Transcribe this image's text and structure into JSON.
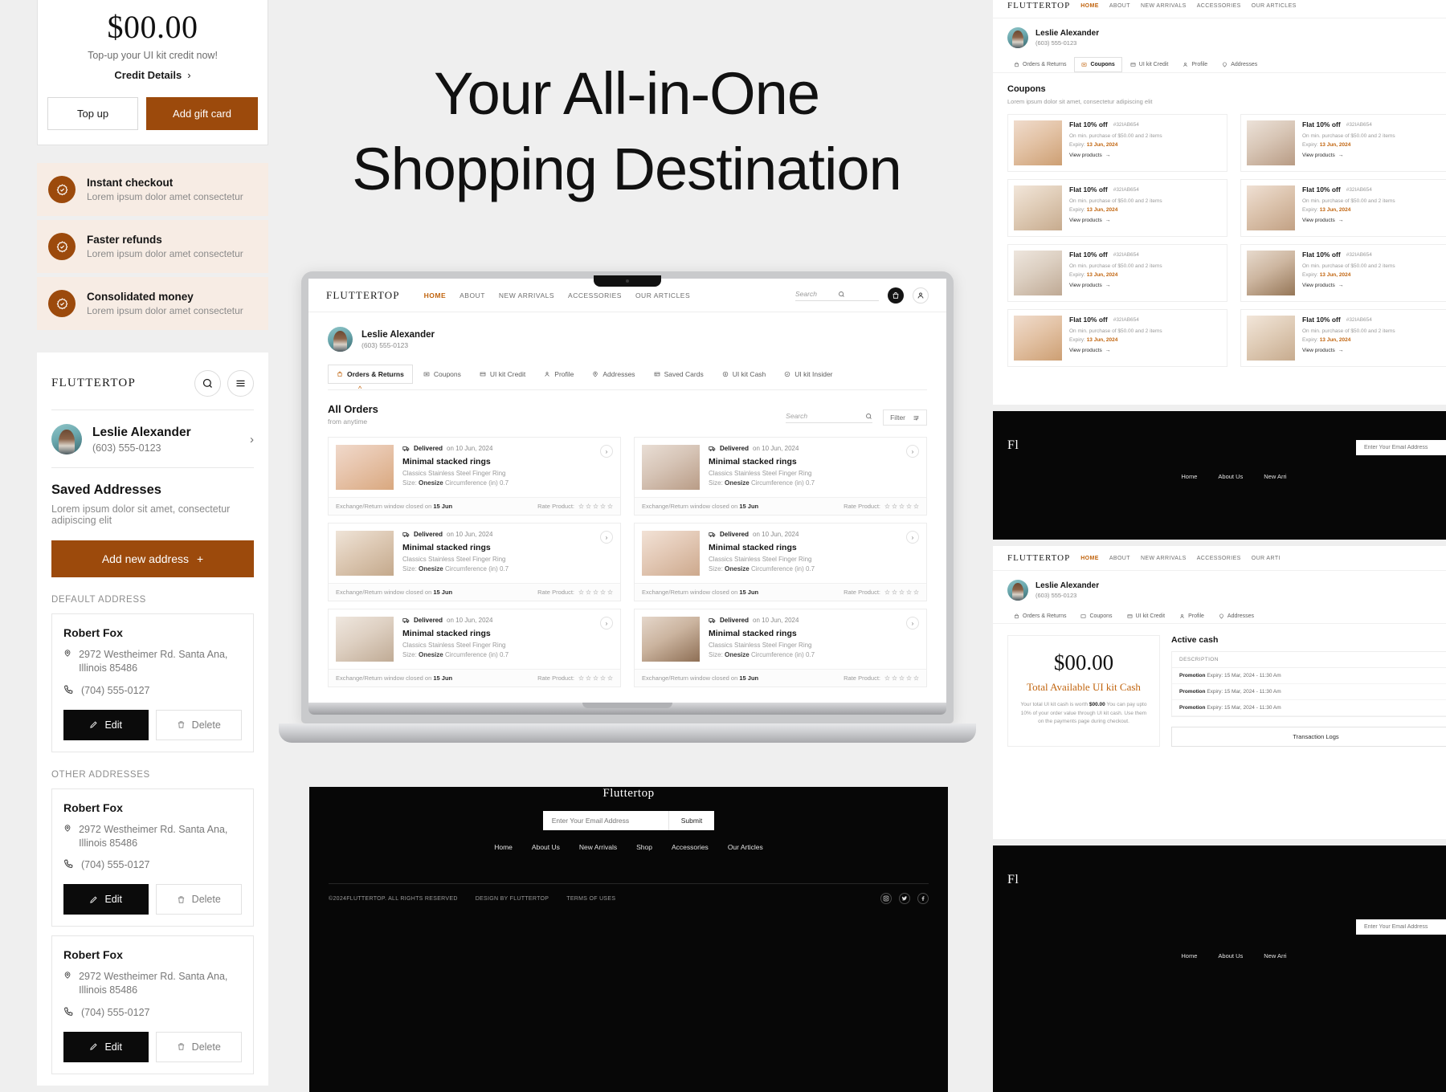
{
  "hero": {
    "line1": "Your All-in-One",
    "line2": "Shopping Destination"
  },
  "credit": {
    "amount": "$00.00",
    "subtitle": "Top-up your UI kit credit now!",
    "details_link": "Credit Details",
    "chevron": "›",
    "topup_label": "Top up",
    "gift_label": "Add gift card"
  },
  "features": [
    {
      "title": "Instant checkout",
      "desc": "Lorem ipsum dolor amet consectetur"
    },
    {
      "title": "Faster refunds",
      "desc": "Lorem ipsum dolor amet consectetur"
    },
    {
      "title": "Consolidated money",
      "desc": "Lorem ipsum dolor amet consectetur"
    }
  ],
  "address_panel": {
    "brand": "FLUTTERTOP",
    "user": {
      "name": "Leslie Alexander",
      "phone": "(603) 555-0123",
      "chevron": "›"
    },
    "section_title": "Saved Addresses",
    "section_desc": "Lorem ipsum dolor sit amet, consectetur adipiscing elit",
    "add_label": "Add new address",
    "add_plus": "+",
    "default_label": "DEFAULT ADDRESS",
    "other_label": "OTHER ADDRESSES",
    "edit_label": "Edit",
    "delete_label": "Delete",
    "addresses": [
      {
        "name": "Robert Fox",
        "street": "2972 Westheimer Rd. Santa Ana, Illinois 85486",
        "phone": "(704) 555-0127"
      },
      {
        "name": "Robert Fox",
        "street": "2972 Westheimer Rd. Santa Ana, Illinois 85486",
        "phone": "(704) 555-0127"
      },
      {
        "name": "Robert Fox",
        "street": "2972 Westheimer Rd. Santa Ana, Illinois 85486",
        "phone": "(704) 555-0127"
      }
    ]
  },
  "laptop": {
    "nav": {
      "logo": "FLUTTERTOP",
      "links": [
        "HOME",
        "ABOUT",
        "NEW ARRIVALS",
        "ACCESSORIES",
        "OUR ARTICLES"
      ],
      "active": "HOME",
      "search_placeholder": "Search"
    },
    "user": {
      "name": "Leslie Alexander",
      "phone": "(603) 555-0123"
    },
    "tabs": [
      "Orders & Returns",
      "Coupons",
      "UI kit Credit",
      "Profile",
      "Addresses",
      "Saved Cards",
      "UI kit Cash",
      "UI kit Insider"
    ],
    "active_tab": "Orders & Returns",
    "orders_header": {
      "title": "All Orders",
      "subtitle": "from anytime",
      "search_placeholder": "Search",
      "filter_label": "Filter"
    },
    "order_labels": {
      "status": "Delivered",
      "status_date": "on 10 Jun, 2024",
      "exchange_prefix": "Exchange/Return window closed on",
      "exchange_date": "15 Jun",
      "rate_label": "Rate Product:"
    },
    "orders": [
      {
        "name": "Minimal stacked rings",
        "desc": "Classics Stainless Steel Finger Ring",
        "size_label": "Size:",
        "size_value": "Onesize",
        "circ": "Circumference (in) 0.7"
      },
      {
        "name": "Minimal stacked rings",
        "desc": "Classics Stainless Steel Finger Ring",
        "size_label": "Size:",
        "size_value": "Onesize",
        "circ": "Circumference (in) 0.7"
      },
      {
        "name": "Minimal stacked rings",
        "desc": "Classics Stainless Steel Finger Ring",
        "size_label": "Size:",
        "size_value": "Onesize",
        "circ": "Circumference (in) 0.7"
      },
      {
        "name": "Minimal stacked rings",
        "desc": "Classics Stainless Steel Finger Ring",
        "size_label": "Size:",
        "size_value": "Onesize",
        "circ": "Circumference (in) 0.7"
      },
      {
        "name": "Minimal stacked rings",
        "desc": "Classics Stainless Steel Finger Ring",
        "size_label": "Size:",
        "size_value": "Onesize",
        "circ": "Circumference (in) 0.7"
      },
      {
        "name": "Minimal stacked rings",
        "desc": "Classics Stainless Steel Finger Ring",
        "size_label": "Size:",
        "size_value": "Onesize",
        "circ": "Circumference (in) 0.7"
      }
    ],
    "footer": {
      "logo": "Fluttertop",
      "email_placeholder": "Enter Your Email Address",
      "submit_label": "Submit",
      "links": [
        "Home",
        "About Us",
        "New Arrivals",
        "Shop",
        "Accessories",
        "Our Articles"
      ],
      "copyright": "©2024FLUTTERTOP. ALL RIGHTS RESERVED",
      "design_by": "DESIGN BY FLUTTERTOP",
      "terms": "TERMS OF USES"
    }
  },
  "preview_coupons": {
    "nav": {
      "logo": "FLUTTERTOP",
      "links": [
        "HOME",
        "ABOUT",
        "NEW ARRIVALS",
        "ACCESSORIES",
        "OUR ARTICLES"
      ],
      "active": "HOME"
    },
    "user": {
      "name": "Leslie Alexander",
      "phone": "(603) 555-0123"
    },
    "tabs": [
      "Orders & Returns",
      "Coupons",
      "UI kit Credit",
      "Profile",
      "Addresses"
    ],
    "active_tab": "Coupons",
    "title": "Coupons",
    "subtitle": "Lorem ipsum dolor sit amet, consectetur adipiscing elit",
    "labels": {
      "condition": "On min. purchase of $50.00 and 2 items",
      "expiry_prefix": "Expiry:",
      "expiry_date": "13 Jun, 2024",
      "view_label": "View products",
      "arrow": "→"
    },
    "items": [
      {
        "off": "Flat 10% off",
        "code": "#32IAB654"
      },
      {
        "off": "Flat 10% off",
        "code": "#32IAB654"
      },
      {
        "off": "Flat 10% off",
        "code": "#32IAB654"
      },
      {
        "off": "Flat 10% off",
        "code": "#32IAB654"
      },
      {
        "off": "Flat 10% off",
        "code": "#32IAB654"
      },
      {
        "off": "Flat 10% off",
        "code": "#32IAB654"
      },
      {
        "off": "Flat 10% off",
        "code": "#32IAB654"
      },
      {
        "off": "Flat 10% off",
        "code": "#32IAB654"
      }
    ]
  },
  "preview_footer_dark": {
    "logo": "Fl",
    "email_placeholder": "Enter Your Email Address",
    "links": [
      "Home",
      "About Us",
      "New Arri"
    ]
  },
  "preview_cash": {
    "nav": {
      "logo": "FLUTTERTOP",
      "links": [
        "HOME",
        "ABOUT",
        "NEW ARRIVALS",
        "ACCESSORIES",
        "OUR ARTI"
      ],
      "active": "HOME"
    },
    "user": {
      "name": "Leslie Alexander",
      "phone": "(603) 555-0123"
    },
    "tabs": [
      "Orders & Returns",
      "Coupons",
      "UI kit Credit",
      "Profile",
      "Addresses"
    ],
    "active_tab": "UI kit Cash",
    "amount": "$00.00",
    "amount_label": "Total Available UI kit Cash",
    "description_1": "Your total UI kit cash is worth",
    "description_amount": "$00.00",
    "description_2": "You can pay upto 10% of your order value through UI kit cash. Use them on the payments page during checkout.",
    "active_title": "Active cash",
    "table_header": "DESCRIPTION",
    "rows": [
      {
        "label": "Promotion",
        "meta": "Expiry: 15 Mar, 2024 - 11:30 Am"
      },
      {
        "label": "Promotion",
        "meta": "Expiry: 15 Mar, 2024 - 11:30 Am"
      },
      {
        "label": "Promotion",
        "meta": "Expiry: 15 Mar, 2024 - 11:30 Am"
      }
    ],
    "button_label": "Transaction Logs"
  },
  "preview_footer_dark2": {
    "logo": "Fl",
    "email_placeholder": "Enter Your Email Address",
    "links": [
      "Home",
      "About Us",
      "New Arri"
    ]
  },
  "colors": {
    "accent": "#9c4a0c",
    "nav_active": "#c1640e",
    "dark": "#070707",
    "feature_bg": "#f7ece4"
  }
}
